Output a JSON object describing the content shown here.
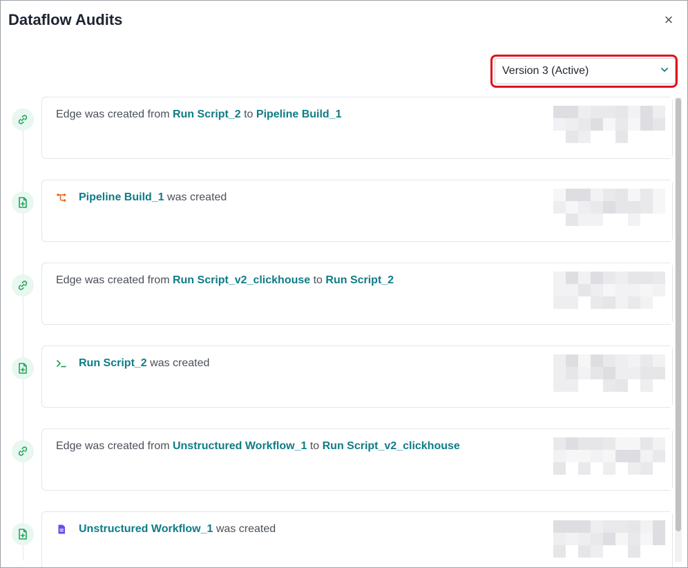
{
  "window": {
    "title": "Dataflow Audits",
    "close_icon": "close-icon"
  },
  "version_select": {
    "value": "Version 3 (Active)",
    "highlight_color": "#e0101a"
  },
  "colors": {
    "accent": "#0e7c86",
    "node_bg": "#e8f7ef",
    "node_icon": "#22a35a",
    "pipeline_icon": "#f26522",
    "script_icon": "#22a35a",
    "workflow_icon": "#6b4de6"
  },
  "audits": [
    {
      "node_icon": "link-icon",
      "parts": [
        {
          "t": "Edge was created from ",
          "link": false
        },
        {
          "t": "Run Script_2",
          "link": true
        },
        {
          "t": " to ",
          "link": false
        },
        {
          "t": "Pipeline Build_1",
          "link": true
        }
      ]
    },
    {
      "node_icon": "file-plus-icon",
      "type_icon": "pipeline-icon",
      "parts": [
        {
          "t": "Pipeline Build_1",
          "link": true
        },
        {
          "t": " was created",
          "link": false
        }
      ]
    },
    {
      "node_icon": "link-icon",
      "parts": [
        {
          "t": "Edge was created from ",
          "link": false
        },
        {
          "t": "Run Script_v2_clickhouse",
          "link": true
        },
        {
          "t": " to ",
          "link": false
        },
        {
          "t": "Run Script_2",
          "link": true
        }
      ]
    },
    {
      "node_icon": "file-plus-icon",
      "type_icon": "terminal-icon",
      "parts": [
        {
          "t": "Run Script_2",
          "link": true
        },
        {
          "t": " was created",
          "link": false
        }
      ]
    },
    {
      "node_icon": "link-icon",
      "parts": [
        {
          "t": "Edge was created from ",
          "link": false
        },
        {
          "t": "Unstructured Workflow_1",
          "link": true
        },
        {
          "t": " to ",
          "link": false
        },
        {
          "t": "Run Script_v2_clickhouse",
          "link": true
        }
      ]
    },
    {
      "node_icon": "file-plus-icon",
      "type_icon": "document-icon",
      "parts": [
        {
          "t": "Unstructured Workflow_1",
          "link": true
        },
        {
          "t": " was created",
          "link": false
        }
      ]
    }
  ]
}
